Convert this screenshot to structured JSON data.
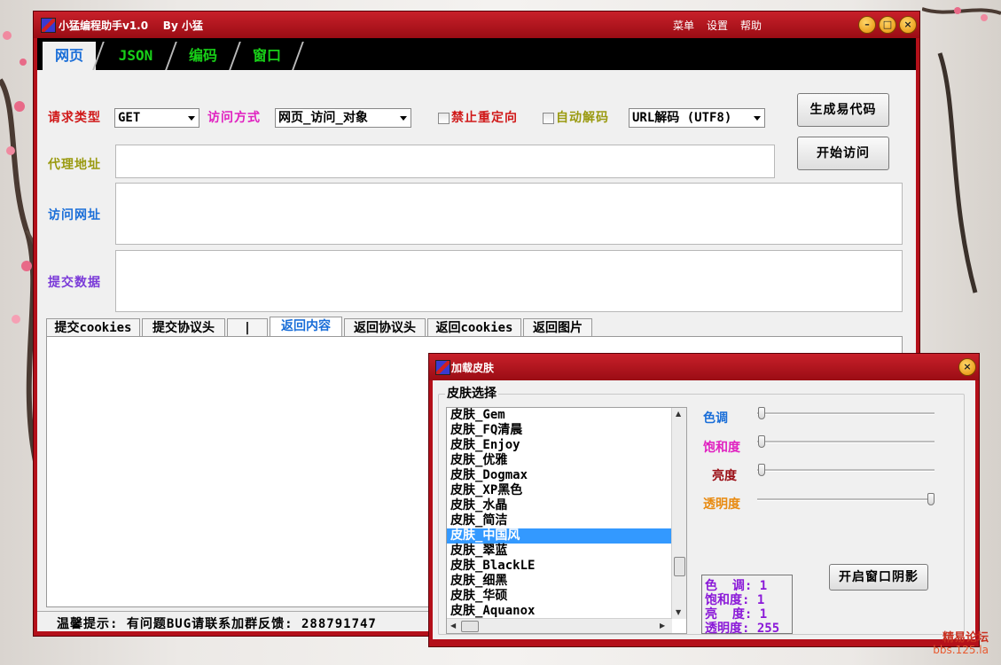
{
  "window": {
    "title": "小猛编程助手v1.0    By 小猛",
    "menu": [
      "菜单",
      "设置",
      "帮助"
    ],
    "tabs": [
      "网页",
      "JSON",
      "编码",
      "窗口"
    ]
  },
  "request": {
    "type_label": "请求类型",
    "type_value": "GET",
    "method_label": "访问方式",
    "method_value": "网页_访问_对象",
    "no_redirect_label": "禁止重定向",
    "auto_decode_label": "自动解码",
    "decode_value": "URL解码 (UTF8)",
    "gen_code_button": "生成易代码",
    "start_button": "开始访问",
    "proxy_label": "代理地址",
    "proxy_value": "",
    "url_label": "访问网址",
    "url_value": "",
    "post_label": "提交数据",
    "post_value": ""
  },
  "subtabs": [
    "提交cookies",
    "提交协议头",
    "|",
    "返回内容",
    "返回协议头",
    "返回cookies",
    "返回图片"
  ],
  "status": "温馨提示: 有问题BUG请联系加群反馈: 288791747",
  "skin_dialog": {
    "title": "加载皮肤",
    "group_label": "皮肤选择",
    "skins": [
      "皮肤_Gem",
      "皮肤_FQ清晨",
      "皮肤_Enjoy",
      "皮肤_优雅",
      "皮肤_Dogmax",
      "皮肤_XP黑色",
      "皮肤_水晶",
      "皮肤_简洁",
      "皮肤_中国风",
      "皮肤_翠蓝",
      "皮肤_BlackLE",
      "皮肤_细黑",
      "皮肤_华硕",
      "皮肤_Aquanox"
    ],
    "selected_index": 8,
    "sliders": [
      {
        "label": "色调",
        "value": 1,
        "max": 255
      },
      {
        "label": "饱和度",
        "value": 1,
        "max": 255
      },
      {
        "label": "亮度",
        "value": 1,
        "max": 255
      },
      {
        "label": "透明度",
        "value": 255,
        "max": 255
      }
    ],
    "info": [
      "色  调: 1",
      "饱和度: 1",
      "亮  度: 1",
      "透明度: 255"
    ],
    "shadow_button": "开启窗口阴影"
  },
  "watermark": [
    "精易论坛",
    "bbs.125.la"
  ],
  "colors": {
    "frame": "#b4101a",
    "label_red": "#d01818",
    "label_magenta": "#e020c0",
    "label_olive": "#9a9a10",
    "label_blue": "#1a6ed8",
    "label_purple": "#7a3ad8",
    "tab_green": "#18d018"
  }
}
